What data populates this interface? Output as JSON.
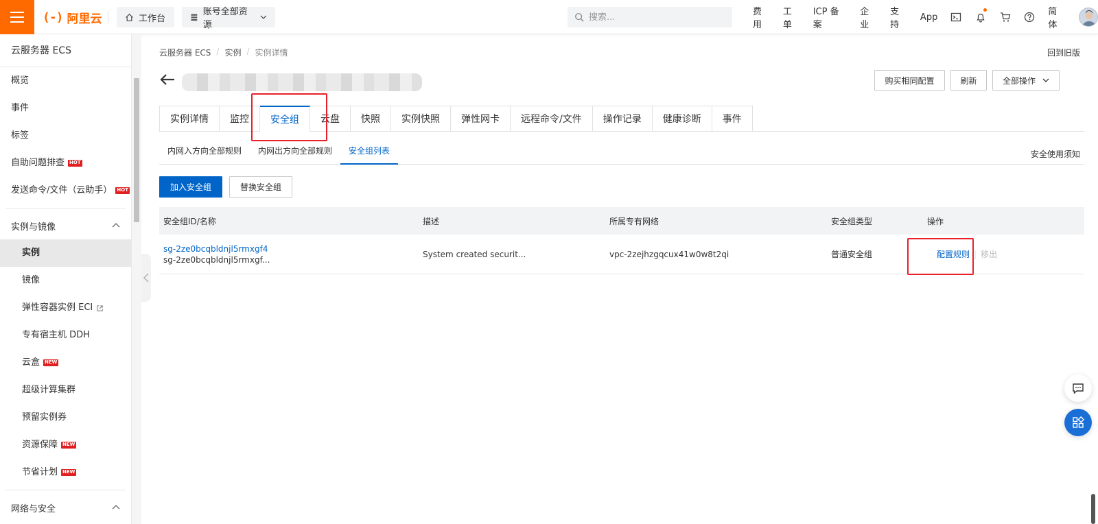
{
  "topbar": {
    "logo_text": "阿里云",
    "workbench": "工作台",
    "resource_scope": "账号全部资源",
    "search_placeholder": "搜索...",
    "links": [
      "费用",
      "工单",
      "ICP 备案",
      "企业",
      "支持",
      "App"
    ],
    "lang": "简体"
  },
  "sidebar": {
    "title": "云服务器 ECS",
    "top_items": [
      {
        "label": "概览"
      },
      {
        "label": "事件"
      },
      {
        "label": "标签"
      },
      {
        "label": "自助问题排查",
        "badge": "HOT"
      },
      {
        "label": "发送命令/文件（云助手）",
        "badge": "HOT"
      }
    ],
    "group_instances": "实例与镜像",
    "instance_items": [
      {
        "label": "实例",
        "active": true
      },
      {
        "label": "镜像"
      },
      {
        "label": "弹性容器实例 ECI"
      },
      {
        "label": "专有宿主机 DDH"
      },
      {
        "label": "云盒",
        "badge": "NEW"
      },
      {
        "label": "超级计算集群"
      },
      {
        "label": "预留实例券"
      },
      {
        "label": "资源保障",
        "badge": "NEW"
      },
      {
        "label": "节省计划",
        "badge": "NEW"
      }
    ],
    "group_network": "网络与安全"
  },
  "breadcrumb": [
    "云服务器 ECS",
    "实例",
    "实例详情"
  ],
  "old_version": "回到旧版",
  "header_buttons": {
    "buy_same": "购买相同配置",
    "refresh": "刷新",
    "all_ops": "全部操作"
  },
  "tabs": [
    "实例详情",
    "监控",
    "安全组",
    "云盘",
    "快照",
    "实例快照",
    "弹性网卡",
    "远程命令/文件",
    "操作记录",
    "健康诊断",
    "事件"
  ],
  "active_tab": "安全组",
  "subtabs": [
    "内网入方向全部规则",
    "内网出方向全部规则",
    "安全组列表"
  ],
  "active_subtab": "安全组列表",
  "safety_notice": "安全使用须知",
  "toolbar": {
    "join": "加入安全组",
    "replace": "替换安全组"
  },
  "table": {
    "headers": [
      "安全组ID/名称",
      "描述",
      "所属专有网络",
      "安全组类型",
      "操作"
    ],
    "rows": [
      {
        "id": "sg-2ze0bcqbldnjl5rmxgf4",
        "name": "sg-2ze0bcqbldnjl5rmxgf...",
        "description": "System created securit...",
        "vpc": "vpc-2zejhzgqcux41w0w8t2qi",
        "type": "普通安全组",
        "op_configure": "配置规则",
        "op_remove": "移出"
      }
    ]
  },
  "colors": {
    "accent": "#0064c8",
    "brand": "#ff6a00",
    "highlight": "#e8202a",
    "badge": "#e02020"
  }
}
